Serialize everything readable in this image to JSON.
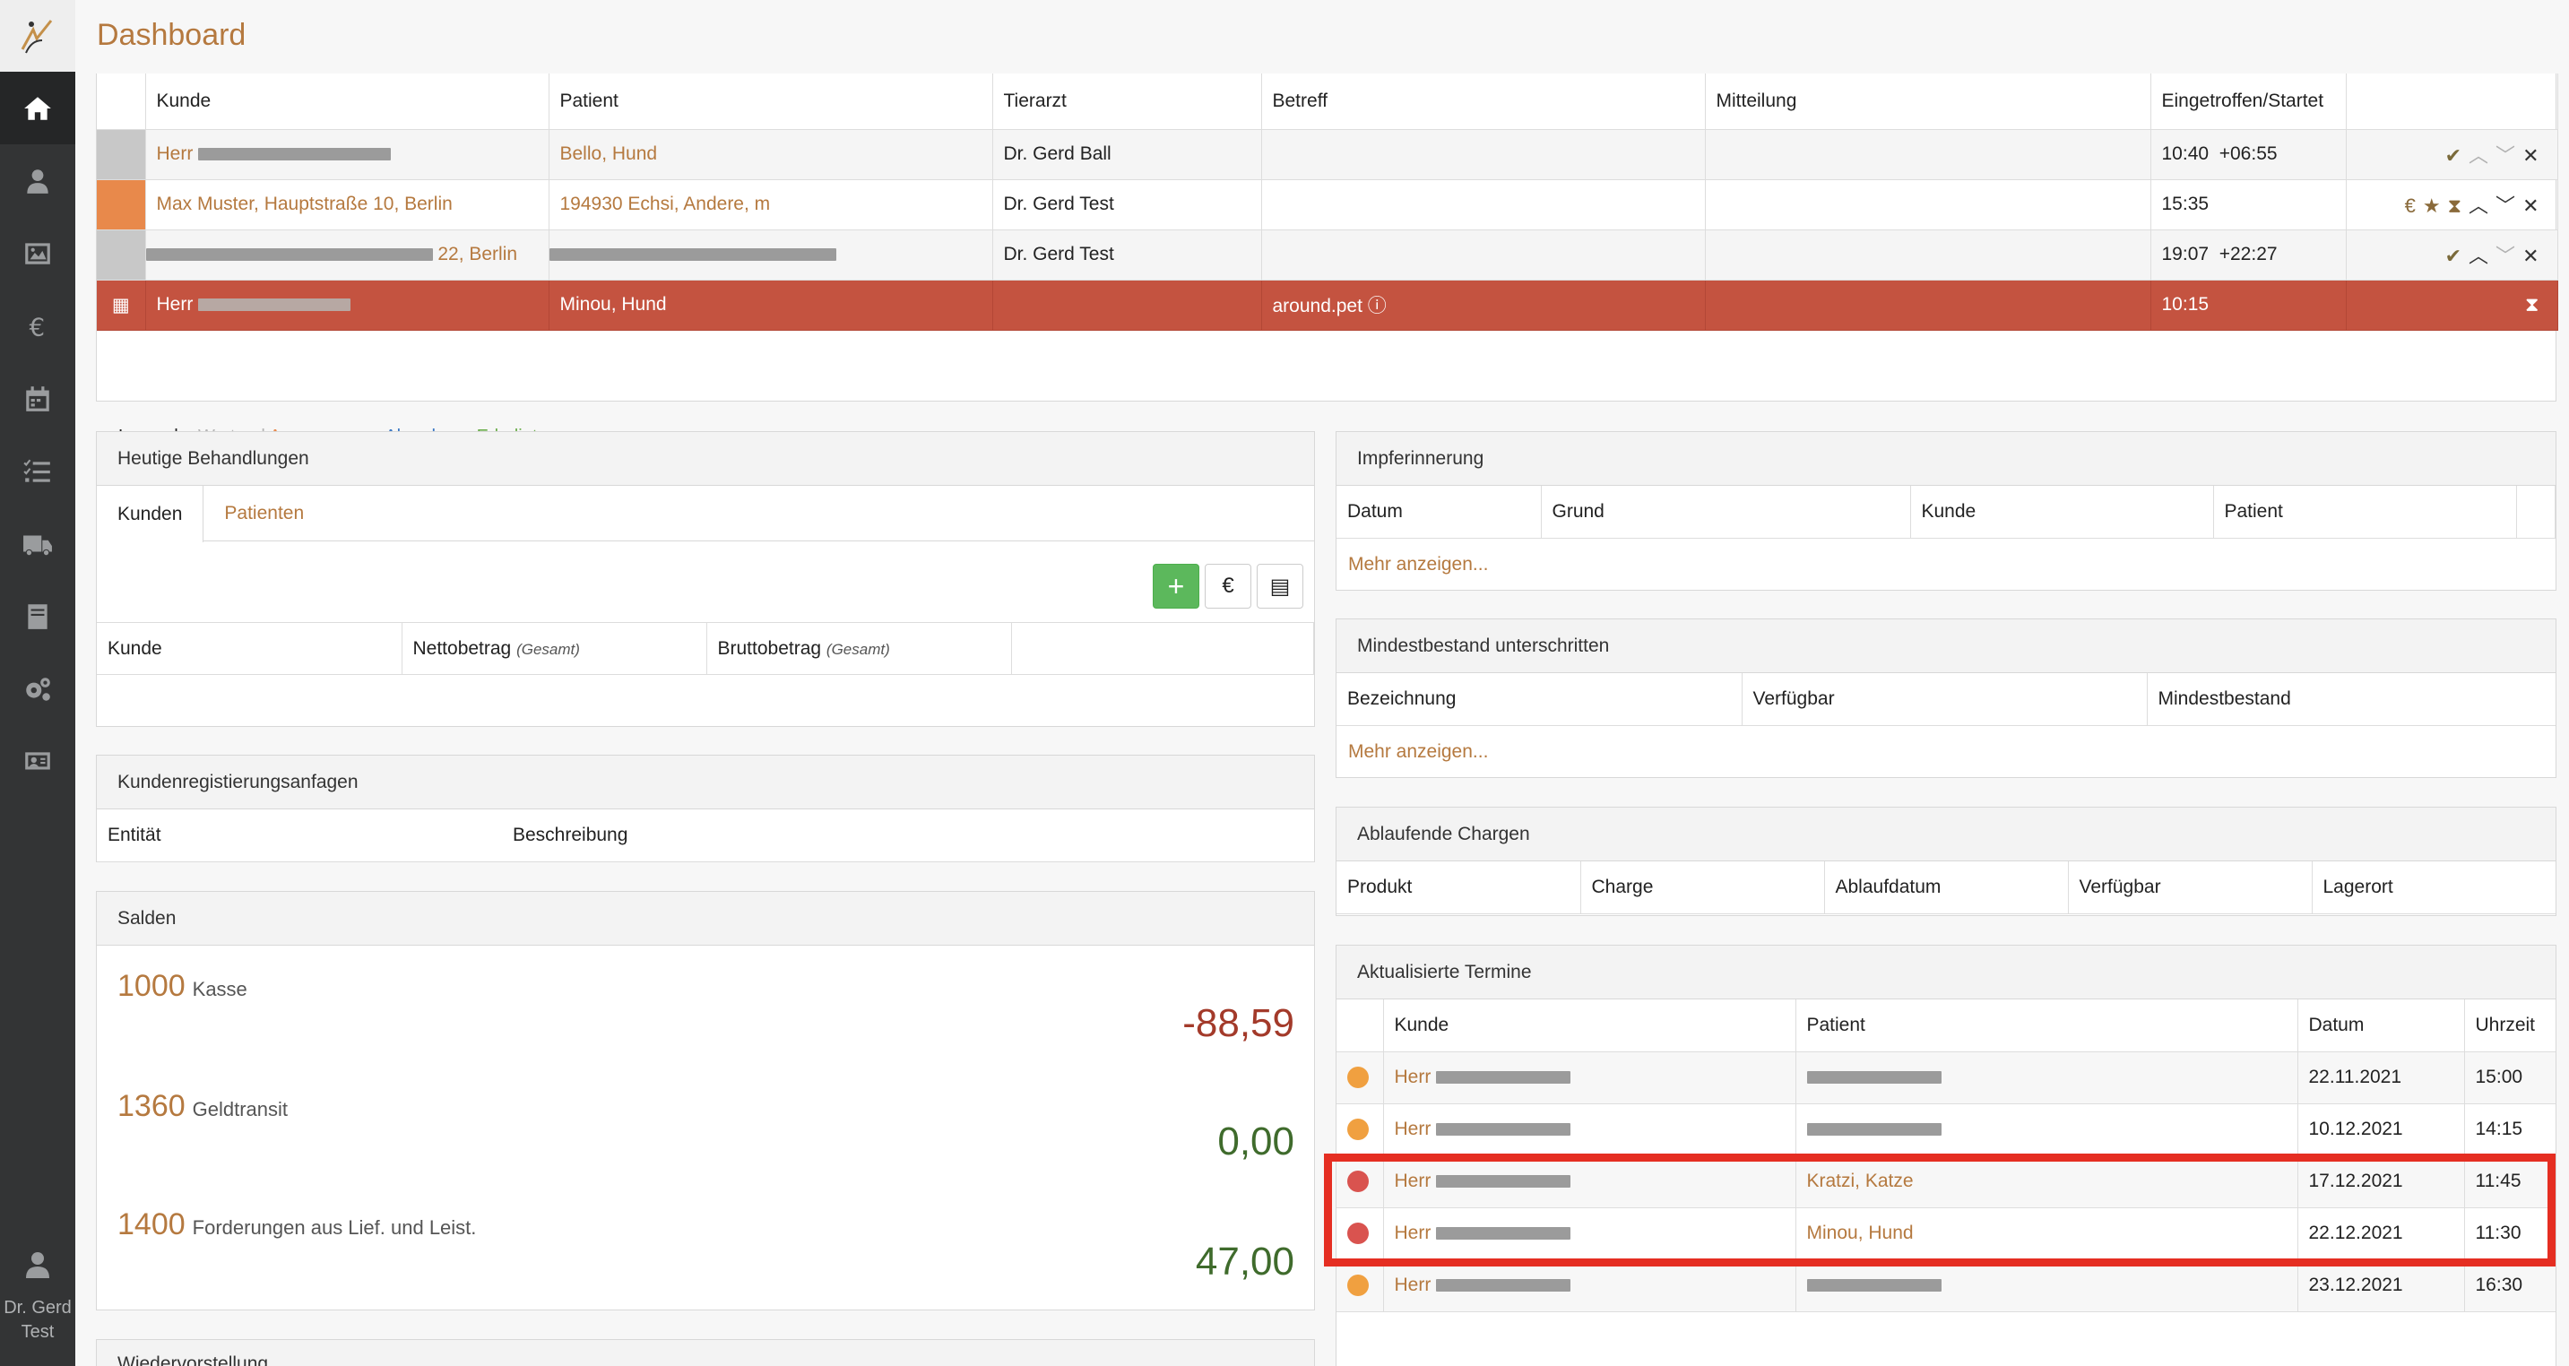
{
  "header": {
    "title": "Dashboard"
  },
  "sidebar": {
    "items": [
      {
        "icon": "home-icon",
        "active": true
      },
      {
        "icon": "user-doctor-icon"
      },
      {
        "icon": "image-icon"
      },
      {
        "icon": "euro-icon"
      },
      {
        "icon": "calendar-icon"
      },
      {
        "icon": "task-list-icon"
      },
      {
        "icon": "truck-icon"
      },
      {
        "icon": "book-icon"
      },
      {
        "icon": "gears-icon"
      },
      {
        "icon": "id-card-icon"
      }
    ],
    "user": {
      "name_line1": "Dr. Gerd",
      "name_line2": "Test"
    }
  },
  "waiting": {
    "headers": [
      "",
      "Kunde",
      "Patient",
      "Tierarzt",
      "Betreff",
      "Mitteilung",
      "Eingetroffen/Startet",
      ""
    ],
    "rows": [
      {
        "status_color": "#c8c8c8",
        "kunde": "Herr",
        "patient": "Bello, Hund",
        "tierarzt": "Dr. Gerd Ball",
        "betreff": "",
        "mitteilung": "",
        "time": "10:40",
        "delta": "+06:55"
      },
      {
        "status_color": "#e8894b",
        "kunde": "Max Muster, Hauptstraße 10, Berlin",
        "patient": "194930 Echsi, Andere, m",
        "tierarzt": "Dr. Gerd Test",
        "betreff": "",
        "mitteilung": "",
        "time": "15:35",
        "delta": ""
      },
      {
        "status_color": "#c8c8c8",
        "kunde": "22, Berlin",
        "patient": "",
        "tierarzt": "Dr. Gerd Test",
        "betreff": "",
        "mitteilung": "",
        "time": "19:07",
        "delta": "+22:27"
      },
      {
        "status_color": "#c45340",
        "kunde": "Herr",
        "patient": "Minou, Hund",
        "tierarzt": "",
        "betreff": "around.pet",
        "mitteilung": "",
        "time": "10:15",
        "delta": ""
      }
    ],
    "legend": {
      "label": "Legende:",
      "wartend": "Wartend",
      "angenommen": "Angenommen",
      "abrechnen": "Abrechnen",
      "erledigt": "Erledigt"
    }
  },
  "behandlungen": {
    "title": "Heutige Behandlungen",
    "tabs": [
      "Kunden",
      "Patienten"
    ],
    "buttons": {
      "add": "+",
      "euro": "€"
    },
    "headers": {
      "kunde": "Kunde",
      "netto": "Nettobetrag",
      "brutto": "Bruttobetrag",
      "gesamt": "(Gesamt)"
    }
  },
  "registrierung": {
    "title": "Kundenregistierungsanfagen",
    "headers": [
      "Entität",
      "Beschreibung"
    ]
  },
  "salden": {
    "title": "Salden",
    "items": [
      {
        "konto": "1000",
        "label": "Kasse",
        "amount": "-88,59",
        "color": "#a33a2a"
      },
      {
        "konto": "1360",
        "label": "Geldtransit",
        "amount": "0,00",
        "color": "#3f6b2c"
      },
      {
        "konto": "1400",
        "label": "Forderungen aus Lief. und Leist.",
        "amount": "47,00",
        "color": "#3f6b2c"
      }
    ]
  },
  "wiedervorstellung": {
    "title": "Wiedervorstellung"
  },
  "impf": {
    "title": "Impferinnerung",
    "headers": [
      "Datum",
      "Grund",
      "Kunde",
      "Patient"
    ],
    "more": "Mehr anzeigen..."
  },
  "mindest": {
    "title": "Mindestbestand unterschritten",
    "headers": [
      "Bezeichnung",
      "Verfügbar",
      "Mindestbestand"
    ],
    "more": "Mehr anzeigen..."
  },
  "chargen": {
    "title": "Ablaufende Chargen",
    "headers": [
      "Produkt",
      "Charge",
      "Ablaufdatum",
      "Verfügbar",
      "Lagerort"
    ]
  },
  "termine": {
    "title": "Aktualisierte Termine",
    "headers": [
      "",
      "Kunde",
      "Patient",
      "Datum",
      "Uhrzeit"
    ],
    "rows": [
      {
        "dot": "#f0a040",
        "kunde": "Herr",
        "patient": "",
        "datum": "22.11.2021",
        "uhrzeit": "15:00"
      },
      {
        "dot": "#f0a040",
        "kunde": "Herr",
        "patient": "",
        "datum": "10.12.2021",
        "uhrzeit": "14:15"
      },
      {
        "dot": "#d9534f",
        "kunde": "Herr",
        "patient": "Kratzi, Katze",
        "datum": "17.12.2021",
        "uhrzeit": "11:45"
      },
      {
        "dot": "#d9534f",
        "kunde": "Herr",
        "patient": "Minou, Hund",
        "datum": "22.12.2021",
        "uhrzeit": "11:30"
      },
      {
        "dot": "#f0a040",
        "kunde": "Herr",
        "patient": "",
        "datum": "23.12.2021",
        "uhrzeit": "16:30"
      }
    ]
  }
}
